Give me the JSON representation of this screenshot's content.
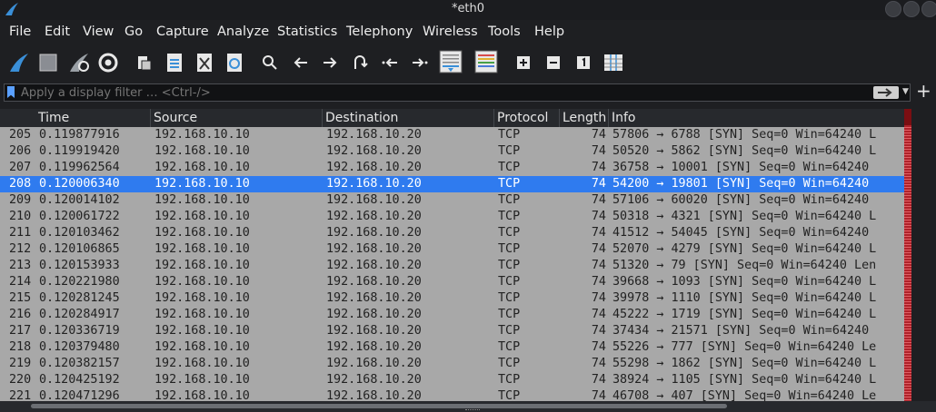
{
  "window": {
    "title": "*eth0"
  },
  "menu": [
    "File",
    "Edit",
    "View",
    "Go",
    "Capture",
    "Analyze",
    "Statistics",
    "Telephony",
    "Wireless",
    "Tools",
    "Help"
  ],
  "filter": {
    "placeholder": "Apply a display filter … <Ctrl-/>"
  },
  "columns": [
    "Time",
    "Source",
    "Destination",
    "Protocol",
    "Length",
    "Info"
  ],
  "selected_row": 3,
  "rows": [
    {
      "no": "205",
      "time": "0.119877916",
      "src": "192.168.10.10",
      "dst": "192.168.10.20",
      "proto": "TCP",
      "len": "74",
      "info": "57806 → 6788 [SYN] Seq=0 Win=64240 L"
    },
    {
      "no": "206",
      "time": "0.119919420",
      "src": "192.168.10.10",
      "dst": "192.168.10.20",
      "proto": "TCP",
      "len": "74",
      "info": "50520 → 5862 [SYN] Seq=0 Win=64240 L"
    },
    {
      "no": "207",
      "time": "0.119962564",
      "src": "192.168.10.10",
      "dst": "192.168.10.20",
      "proto": "TCP",
      "len": "74",
      "info": "36758 → 10001 [SYN] Seq=0 Win=64240"
    },
    {
      "no": "208",
      "time": "0.120006340",
      "src": "192.168.10.10",
      "dst": "192.168.10.20",
      "proto": "TCP",
      "len": "74",
      "info": "54200 → 19801 [SYN] Seq=0 Win=64240"
    },
    {
      "no": "209",
      "time": "0.120014102",
      "src": "192.168.10.10",
      "dst": "192.168.10.20",
      "proto": "TCP",
      "len": "74",
      "info": "57106 → 60020 [SYN] Seq=0 Win=64240"
    },
    {
      "no": "210",
      "time": "0.120061722",
      "src": "192.168.10.10",
      "dst": "192.168.10.20",
      "proto": "TCP",
      "len": "74",
      "info": "50318 → 4321 [SYN] Seq=0 Win=64240 L"
    },
    {
      "no": "211",
      "time": "0.120103462",
      "src": "192.168.10.10",
      "dst": "192.168.10.20",
      "proto": "TCP",
      "len": "74",
      "info": "41512 → 54045 [SYN] Seq=0 Win=64240"
    },
    {
      "no": "212",
      "time": "0.120106865",
      "src": "192.168.10.10",
      "dst": "192.168.10.20",
      "proto": "TCP",
      "len": "74",
      "info": "52070 → 4279 [SYN] Seq=0 Win=64240 L"
    },
    {
      "no": "213",
      "time": "0.120153933",
      "src": "192.168.10.10",
      "dst": "192.168.10.20",
      "proto": "TCP",
      "len": "74",
      "info": "51320 → 79 [SYN] Seq=0 Win=64240 Len"
    },
    {
      "no": "214",
      "time": "0.120221980",
      "src": "192.168.10.10",
      "dst": "192.168.10.20",
      "proto": "TCP",
      "len": "74",
      "info": "39668 → 1093 [SYN] Seq=0 Win=64240 L"
    },
    {
      "no": "215",
      "time": "0.120281245",
      "src": "192.168.10.10",
      "dst": "192.168.10.20",
      "proto": "TCP",
      "len": "74",
      "info": "39978 → 1110 [SYN] Seq=0 Win=64240 L"
    },
    {
      "no": "216",
      "time": "0.120284917",
      "src": "192.168.10.10",
      "dst": "192.168.10.20",
      "proto": "TCP",
      "len": "74",
      "info": "45222 → 1719 [SYN] Seq=0 Win=64240 L"
    },
    {
      "no": "217",
      "time": "0.120336719",
      "src": "192.168.10.10",
      "dst": "192.168.10.20",
      "proto": "TCP",
      "len": "74",
      "info": "37434 → 21571 [SYN] Seq=0 Win=64240"
    },
    {
      "no": "218",
      "time": "0.120379480",
      "src": "192.168.10.10",
      "dst": "192.168.10.20",
      "proto": "TCP",
      "len": "74",
      "info": "55226 → 777 [SYN] Seq=0 Win=64240 Le"
    },
    {
      "no": "219",
      "time": "0.120382157",
      "src": "192.168.10.10",
      "dst": "192.168.10.20",
      "proto": "TCP",
      "len": "74",
      "info": "55298 → 1862 [SYN] Seq=0 Win=64240 L"
    },
    {
      "no": "220",
      "time": "0.120425192",
      "src": "192.168.10.10",
      "dst": "192.168.10.20",
      "proto": "TCP",
      "len": "74",
      "info": "38924 → 1105 [SYN] Seq=0 Win=64240 L"
    },
    {
      "no": "221",
      "time": "0.120471296",
      "src": "192.168.10.10",
      "dst": "192.168.10.20",
      "proto": "TCP",
      "len": "74",
      "info": "46708 → 407 [SYN] Seq=0 Win=64240 Le"
    }
  ]
}
